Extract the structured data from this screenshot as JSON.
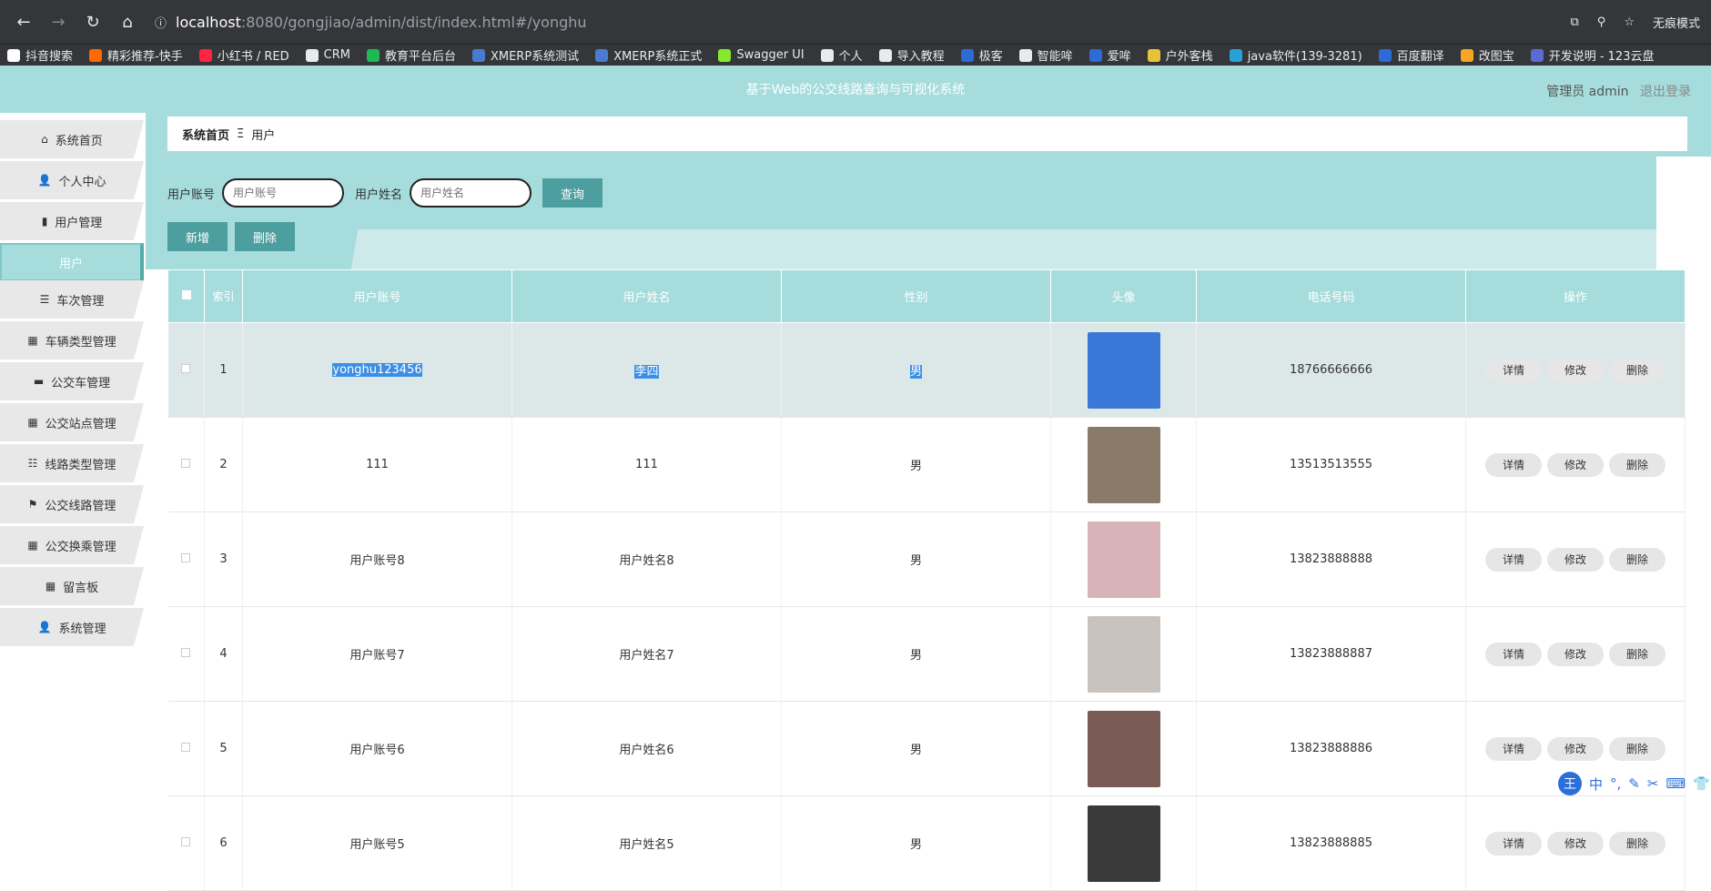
{
  "browser": {
    "url_domain": "localhost",
    "url_path": ":8080/gongjiao/admin/dist/index.html#/yonghu",
    "incognito_label": "无痕模式"
  },
  "bookmarks": [
    {
      "label": "抖音搜索",
      "color": "#fff"
    },
    {
      "label": "精彩推荐-快手",
      "color": "#ff6a00"
    },
    {
      "label": "小红书 / RED",
      "color": "#ff2442"
    },
    {
      "label": "CRM",
      "color": "#e8eaed"
    },
    {
      "label": "教育平台后台",
      "color": "#1db954"
    },
    {
      "label": "XMERP系统测试",
      "color": "#4a7bd0"
    },
    {
      "label": "XMERP系统正式",
      "color": "#4a7bd0"
    },
    {
      "label": "Swagger UI",
      "color": "#85ea2d"
    },
    {
      "label": "个人",
      "color": "#e8eaed"
    },
    {
      "label": "导入教程",
      "color": "#e8eaed"
    },
    {
      "label": "极客",
      "color": "#2d6bd6"
    },
    {
      "label": "智能哞",
      "color": "#e8eaed"
    },
    {
      "label": "爱哞",
      "color": "#2d6bd6"
    },
    {
      "label": "户外客栈",
      "color": "#e8c33a"
    },
    {
      "label": "java软件(139-3281)",
      "color": "#2aa1d6"
    },
    {
      "label": "百度翻译",
      "color": "#2d6bd6"
    },
    {
      "label": "改图宝",
      "color": "#f5a623"
    },
    {
      "label": "开发说明 - 123云盘",
      "color": "#5b6bd6"
    }
  ],
  "header": {
    "title": "基于Web的公交线路查询与可视化系统",
    "user_label": "管理员 admin",
    "logout": "退出登录"
  },
  "sidebar": {
    "items": [
      {
        "label": "系统首页",
        "icon": "⌂"
      },
      {
        "label": "个人中心",
        "icon": "👤"
      },
      {
        "label": "用户管理",
        "icon": "▮"
      },
      {
        "label": "用户",
        "sub": true
      },
      {
        "label": "车次管理",
        "icon": "☰"
      },
      {
        "label": "车辆类型管理",
        "icon": "▦"
      },
      {
        "label": "公交车管理",
        "icon": "▬"
      },
      {
        "label": "公交站点管理",
        "icon": "▦"
      },
      {
        "label": "线路类型管理",
        "icon": "☷"
      },
      {
        "label": "公交线路管理",
        "icon": "⚑"
      },
      {
        "label": "公交换乘管理",
        "icon": "▦"
      },
      {
        "label": "留言板",
        "icon": "▦"
      },
      {
        "label": "系统管理",
        "icon": "👤"
      }
    ]
  },
  "breadcrumb": {
    "home": "系统首页",
    "sep": "Ξ",
    "current": "用户"
  },
  "search": {
    "account_label": "用户账号",
    "account_placeholder": "用户账号",
    "name_label": "用户姓名",
    "name_placeholder": "用户姓名",
    "query_button": "查询"
  },
  "actions": {
    "add": "新增",
    "delete": "删除"
  },
  "table": {
    "headers": [
      "索引",
      "用户账号",
      "用户姓名",
      "性别",
      "头像",
      "电话号码",
      "操作"
    ],
    "row_buttons": [
      "详情",
      "修改",
      "删除"
    ],
    "rows": [
      {
        "idx": "1",
        "account": "yonghu123456",
        "name": "李四",
        "gender": "男",
        "phone": "18766666666",
        "selected": true,
        "avatar": "#3a78d8"
      },
      {
        "idx": "2",
        "account": "111",
        "name": "111",
        "gender": "男",
        "phone": "13513513555",
        "avatar": "#8a7a6a"
      },
      {
        "idx": "3",
        "account": "用户账号8",
        "name": "用户姓名8",
        "gender": "男",
        "phone": "13823888888",
        "avatar": "#d8b4b8"
      },
      {
        "idx": "4",
        "account": "用户账号7",
        "name": "用户姓名7",
        "gender": "男",
        "phone": "13823888887",
        "avatar": "#c9c2bc"
      },
      {
        "idx": "5",
        "account": "用户账号6",
        "name": "用户姓名6",
        "gender": "男",
        "phone": "13823888886",
        "avatar": "#7a5a55"
      },
      {
        "idx": "6",
        "account": "用户账号5",
        "name": "用户姓名5",
        "gender": "男",
        "phone": "13823888885",
        "avatar": "#3a3a3a"
      }
    ]
  }
}
